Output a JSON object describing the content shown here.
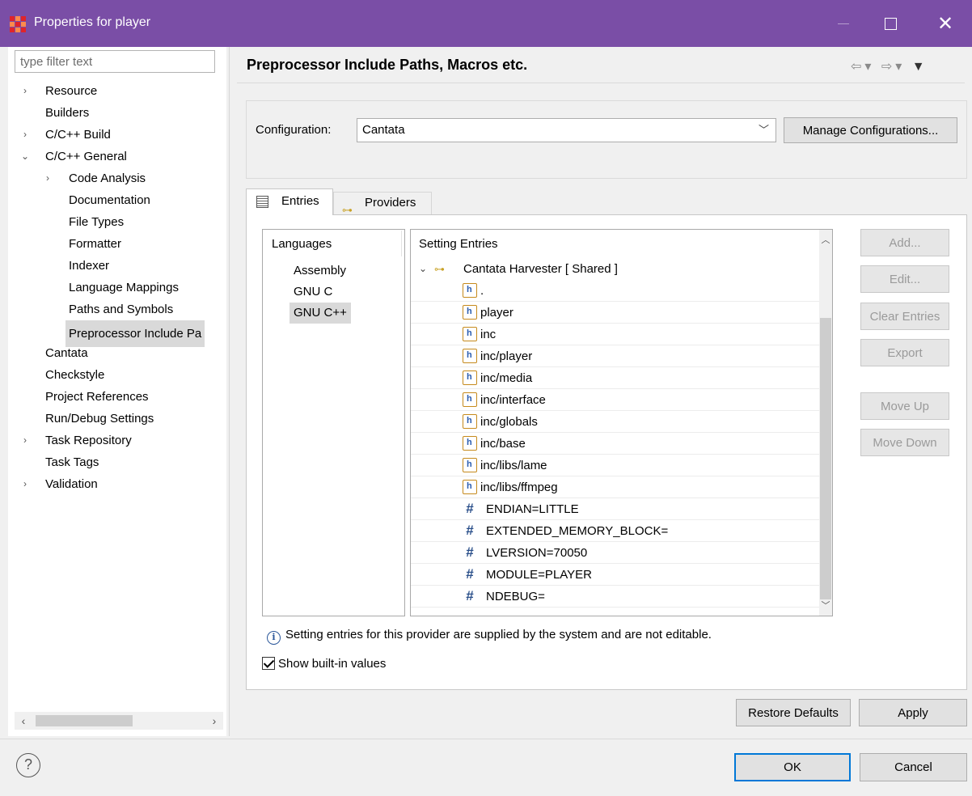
{
  "window": {
    "title": "Properties for player",
    "close_glyph": "✕"
  },
  "filter": {
    "placeholder": "type filter text"
  },
  "tree": {
    "items": [
      {
        "label": "Resource",
        "twisty": "›"
      },
      {
        "label": "Builders",
        "twisty": ""
      },
      {
        "label": "C/C++ Build",
        "twisty": "›"
      },
      {
        "label": "C/C++ General",
        "twisty": "⌄"
      },
      {
        "label": "Code Analysis",
        "twisty": "›"
      },
      {
        "label": "Documentation",
        "twisty": ""
      },
      {
        "label": "File Types",
        "twisty": ""
      },
      {
        "label": "Formatter",
        "twisty": ""
      },
      {
        "label": "Indexer",
        "twisty": ""
      },
      {
        "label": "Language Mappings",
        "twisty": ""
      },
      {
        "label": "Paths and Symbols",
        "twisty": ""
      },
      {
        "label": "Preprocessor Include Pa",
        "twisty": ""
      },
      {
        "label": "Cantata",
        "twisty": ""
      },
      {
        "label": "Checkstyle",
        "twisty": ""
      },
      {
        "label": "Project References",
        "twisty": ""
      },
      {
        "label": "Run/Debug Settings",
        "twisty": ""
      },
      {
        "label": "Task Repository",
        "twisty": "›"
      },
      {
        "label": "Task Tags",
        "twisty": ""
      },
      {
        "label": "Validation",
        "twisty": "›"
      }
    ],
    "scroll_left": "‹",
    "scroll_right": "›"
  },
  "page": {
    "title": "Preprocessor Include Paths, Macros etc.",
    "nav": {
      "back": "⇦",
      "back_menu": "▾",
      "forward": "⇨",
      "forward_menu": "▾",
      "view_menu": "▼"
    }
  },
  "configuration": {
    "label": "Configuration:",
    "value": "Cantata",
    "chevron": "﹀",
    "manage_button": "Manage Configurations..."
  },
  "tabs": [
    {
      "label": "Entries",
      "active": true
    },
    {
      "label": "Providers",
      "active": false
    }
  ],
  "languages": {
    "header": "Languages",
    "items": [
      "Assembly",
      "GNU C",
      "GNU C++"
    ],
    "selected": "GNU C++"
  },
  "entries": {
    "header": "Setting Entries",
    "group": {
      "label": "Cantata Harvester   [ Shared ]",
      "twisty": "⌄"
    },
    "paths": [
      ".",
      "player",
      "inc",
      "inc/player",
      "inc/media",
      "inc/interface",
      "inc/globals",
      "inc/base",
      "inc/libs/lame",
      "inc/libs/ffmpeg"
    ],
    "macros": [
      "ENDIAN=LITTLE",
      "EXTENDED_MEMORY_BLOCK=",
      "LVERSION=70050",
      "MODULE=PLAYER",
      "NDEBUG="
    ],
    "macro_glyph": "#",
    "scroll_up": "︿",
    "scroll_down": "﹀"
  },
  "actions": {
    "add": "Add...",
    "edit": "Edit...",
    "clear": "Clear Entries",
    "export": "Export",
    "move_up": "Move Up",
    "move_down": "Move Down"
  },
  "info": {
    "icon": "i",
    "text": "Setting entries for this provider are supplied by the system and are not editable."
  },
  "show_builtin": {
    "label": "Show built-in values",
    "checked": true
  },
  "footer": {
    "restore_defaults": "Restore Defaults",
    "apply": "Apply",
    "ok": "OK",
    "cancel": "Cancel",
    "help": "?"
  }
}
